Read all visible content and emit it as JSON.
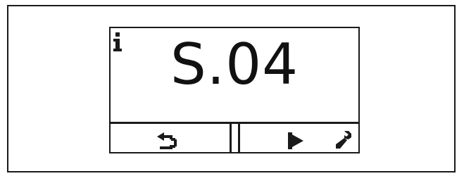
{
  "display": {
    "status_code": "S.04",
    "icons": {
      "info": "info-icon",
      "back": "back-arrow-icon",
      "play": "play-icon",
      "service": "wrench-icon"
    }
  },
  "colors": {
    "foreground": "#1a1a1a",
    "background": "#ffffff"
  }
}
